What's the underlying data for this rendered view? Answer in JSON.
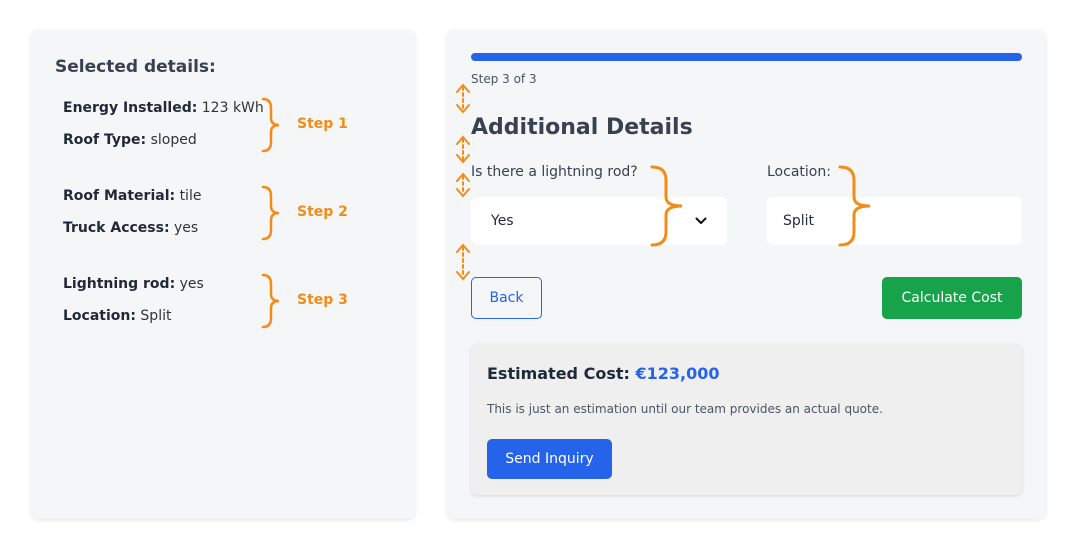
{
  "summary": {
    "title": "Selected details:",
    "items": [
      {
        "label": "Energy Installed:",
        "value": "123 kWh"
      },
      {
        "label": "Roof Type:",
        "value": "sloped"
      },
      {
        "label": "Roof Material:",
        "value": "tile"
      },
      {
        "label": "Truck Access:",
        "value": "yes"
      },
      {
        "label": "Lightning rod:",
        "value": "yes"
      },
      {
        "label": "Location:",
        "value": "Split"
      }
    ],
    "steps": [
      "Step 1",
      "Step 2",
      "Step 3"
    ]
  },
  "form": {
    "progress_percent": 100,
    "step_indicator": "Step 3 of 3",
    "title": "Additional Details",
    "lightning_rod": {
      "label": "Is there a lightning rod?",
      "value": "Yes"
    },
    "location": {
      "label": "Location:",
      "value": "Split"
    },
    "back_label": "Back",
    "calculate_label": "Calculate Cost"
  },
  "estimate": {
    "label": "Estimated Cost:",
    "value": "€123,000",
    "note": "This is just an estimation until our team provides an actual quote.",
    "send_label": "Send Inquiry"
  },
  "colors": {
    "accent": "#2563eb",
    "success": "#16a34a",
    "annotation": "#f28c18"
  }
}
